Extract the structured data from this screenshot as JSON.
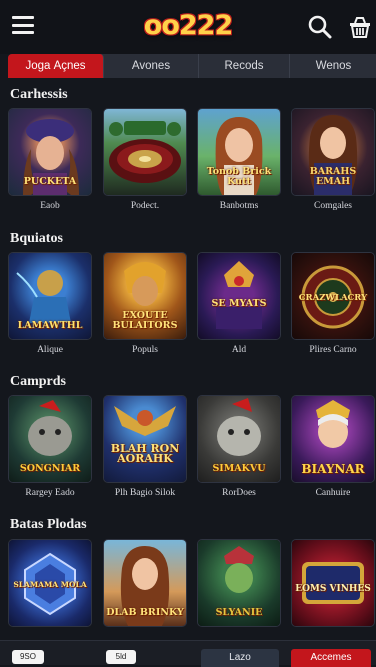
{
  "header": {
    "logo": "oo222",
    "menu_icon": "hamburger-icon",
    "search_icon": "search-icon",
    "basket_icon": "basket-icon"
  },
  "tabs": [
    {
      "label": "Jogа Açnes",
      "active": true
    },
    {
      "label": "Avones",
      "active": false
    },
    {
      "label": "Recods",
      "active": false
    },
    {
      "label": "Wenos",
      "active": false
    }
  ],
  "sections": [
    {
      "title": "Carhessis",
      "games": [
        {
          "label": "Eaob",
          "art": "PUCKETA"
        },
        {
          "label": "Podect.",
          "art": ""
        },
        {
          "label": "Banbotms",
          "art": "Tonob Brick Kutt"
        },
        {
          "label": "Comgales",
          "art": "BARAHS EMAH"
        }
      ]
    },
    {
      "title": "Bquiatos",
      "games": [
        {
          "label": "Alique",
          "art": "LAMAWTHL"
        },
        {
          "label": "Populs",
          "art": "EXOUTE BULAITORS"
        },
        {
          "label": "Ald",
          "art": "SE MYATS"
        },
        {
          "label": "Plires Carno",
          "art": "CRAZWLACRY"
        }
      ]
    },
    {
      "title": "Camprds",
      "games": [
        {
          "label": "Rargey Eado",
          "art": "SONGNIAR"
        },
        {
          "label": "Plh Bagio Silok",
          "art": "BLAH RON AORAHK"
        },
        {
          "label": "RorDoes",
          "art": "SIMAKVU"
        },
        {
          "label": "Canhuire",
          "art": "BIAYNAR"
        }
      ]
    },
    {
      "title": "Batas Plodas",
      "games": [
        {
          "label": "",
          "art": "SLAMAMA MOLA"
        },
        {
          "label": "",
          "art": "DLAB BRINKY"
        },
        {
          "label": "",
          "art": "SLYANIE"
        },
        {
          "label": "",
          "art": "EOMS VINHES"
        }
      ]
    }
  ],
  "footer": {
    "chip1": "9SO",
    "chip2": "5ld",
    "button1": "Lazo",
    "button2": "Accemes"
  },
  "colors": {
    "accent": "#c3161c",
    "background": "#14171d",
    "logo_gold": "#ffd24a"
  }
}
